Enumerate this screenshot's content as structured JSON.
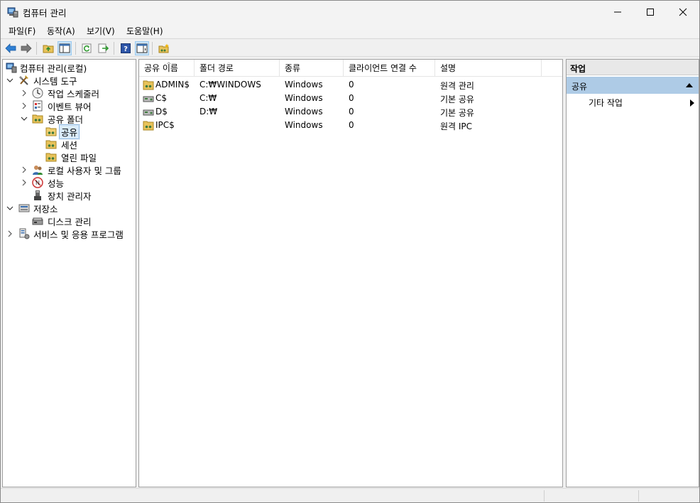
{
  "window": {
    "title": "컴퓨터 관리",
    "app_icon": "computer-management-icon"
  },
  "menu": {
    "items": [
      "파일(F)",
      "동작(A)",
      "보기(V)",
      "도움말(H)"
    ]
  },
  "toolbar": {
    "buttons": [
      "back-icon",
      "forward-icon",
      "up-folder-icon",
      "show-hide-tree-icon",
      "refresh-icon",
      "export-list-icon",
      "help-icon",
      "show-hide-action-pane-icon",
      "new-share-icon"
    ]
  },
  "tree": {
    "root": "컴퓨터 관리(로컬)",
    "system_tools": "시스템 도구",
    "task_scheduler": "작업 스케줄러",
    "event_viewer": "이벤트 뷰어",
    "shared_folders": "공유 폴더",
    "shares": "공유",
    "sessions": "세션",
    "open_files": "열린 파일",
    "local_users": "로컬 사용자 및 그룹",
    "performance": "성능",
    "device_manager": "장치 관리자",
    "storage": "저장소",
    "disk_management": "디스크 관리",
    "services_apps": "서비스 및 응용 프로그램"
  },
  "list": {
    "columns": [
      "공유 이름",
      "폴더 경로",
      "종류",
      "클라이언트 연결 수",
      "설명"
    ],
    "rows": [
      {
        "name": "ADMIN$",
        "path": "C:₩WINDOWS",
        "type": "Windows",
        "clients": "0",
        "desc": "원격 관리"
      },
      {
        "name": "C$",
        "path": "C:₩",
        "type": "Windows",
        "clients": "0",
        "desc": "기본 공유"
      },
      {
        "name": "D$",
        "path": "D:₩",
        "type": "Windows",
        "clients": "0",
        "desc": "기본 공유"
      },
      {
        "name": "IPC$",
        "path": "",
        "type": "Windows",
        "clients": "0",
        "desc": "원격 IPC"
      }
    ]
  },
  "actions": {
    "title": "작업",
    "group": "공유",
    "more": "기타 작업"
  },
  "colors": {
    "selection": "#d9ebfa",
    "action_group": "#aecbe6"
  }
}
